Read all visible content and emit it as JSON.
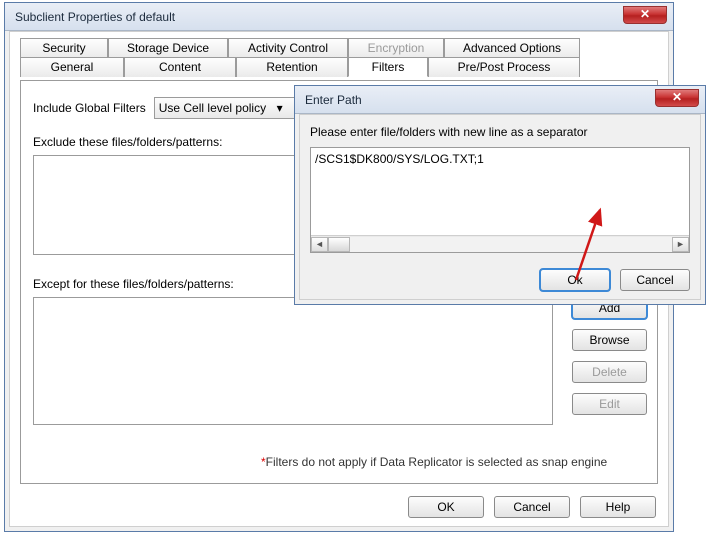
{
  "mainWin": {
    "title": "Subclient Properties of default",
    "tabs_row1": [
      "Security",
      "Storage Device",
      "Activity Control",
      "Encryption",
      "Advanced Options"
    ],
    "tabs_row1_disabled_idx": 3,
    "tabs_row2": [
      "General",
      "Content",
      "Retention",
      "Filters",
      "Pre/Post Process"
    ],
    "tabs_row2_active_idx": 3,
    "includeLabel": "Include Global Filters",
    "includeValue": "Use Cell level policy",
    "excludeLabel": "Exclude these files/folders/patterns:",
    "exceptLabel": "Except for these files/folders/patterns:",
    "sideButtons": [
      "Add",
      "Browse",
      "Delete",
      "Edit"
    ],
    "sideButtons_disabled": [
      2,
      3
    ],
    "note_star": "*",
    "note": "Filters do not apply if Data Replicator is selected as snap engine",
    "footer": [
      "OK",
      "Cancel",
      "Help"
    ]
  },
  "dialog": {
    "title": "Enter Path",
    "instruction": "Please enter file/folders with new line as a separator",
    "value": "/SCS1$DK800/SYS/LOG.TXT;1",
    "ok": "Ok",
    "cancel": "Cancel"
  }
}
